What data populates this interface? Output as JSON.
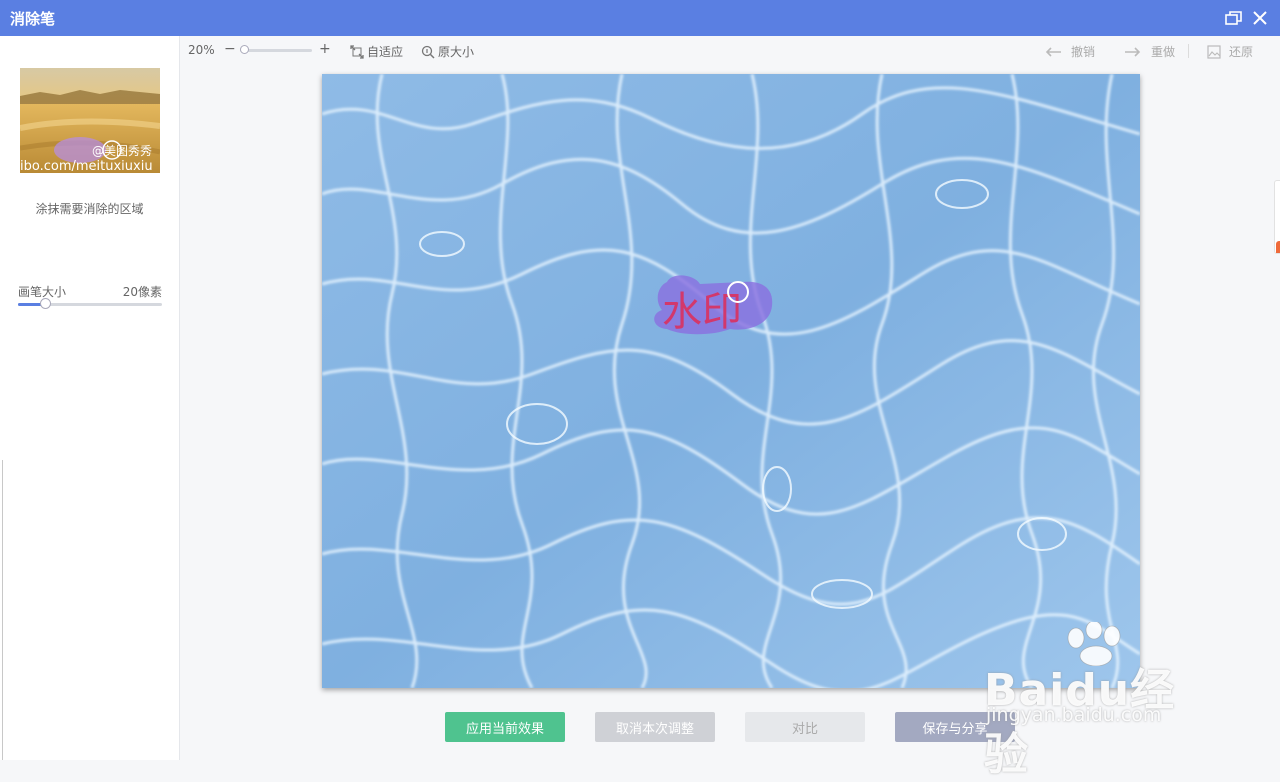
{
  "window": {
    "title": "消除笔"
  },
  "sidebar": {
    "thumbnail_watermark": "@美图秀秀",
    "thumbnail_url_text": "ibo.com/meituxiuxiu",
    "hint": "涂抹需要消除的区域",
    "brush_size_label": "画笔大小",
    "brush_size_value": "20像素",
    "brush_level": 0.19
  },
  "toolbar": {
    "zoom_percent": "20%",
    "zoom_minus": "−",
    "zoom_plus": "+",
    "zoom_level": 0.05,
    "fit_label": "自适应",
    "original_size_label": "原大小",
    "undo_label": "撤销",
    "redo_label": "重做",
    "restore_label": "还原"
  },
  "canvas": {
    "watermark_text": "水印"
  },
  "actions": {
    "apply_label": "应用当前效果",
    "cancel_label": "取消本次调整",
    "compare_label": "对比",
    "save_label": "保存与分享"
  },
  "overlay": {
    "brand_logo": "Baidu经验",
    "brand_url": "jingyan.baidu.com"
  },
  "colors": {
    "titlebar": "#5a7fe2",
    "apply_button": "#4fc38f",
    "cancel_button": "#cfd1d6",
    "save_button": "#a3a9c1",
    "watermark_text": "#d2386c",
    "brush_mark": "#8a6fe0"
  }
}
